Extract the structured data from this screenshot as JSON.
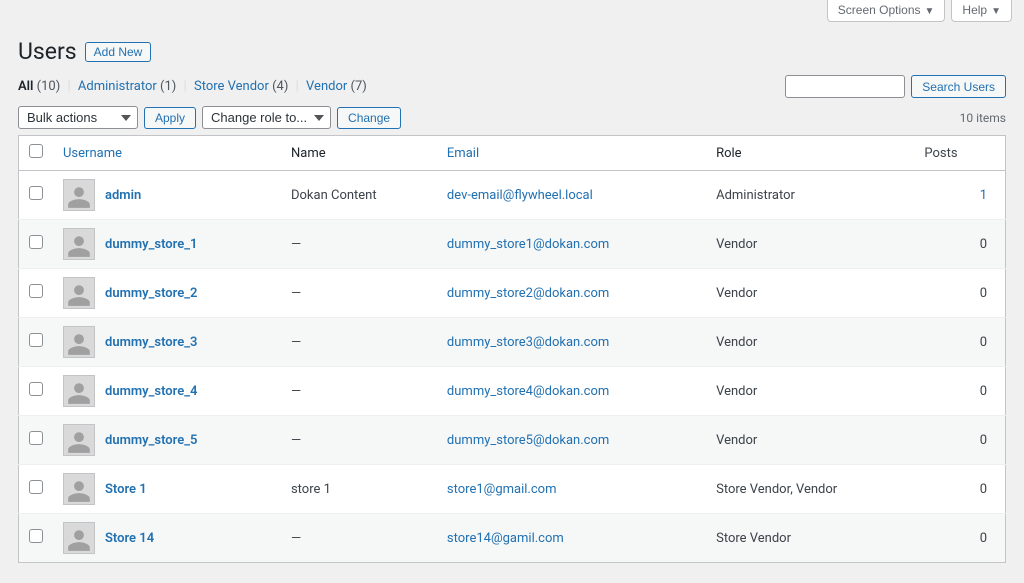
{
  "topbar": {
    "screen_options": "Screen Options",
    "help": "Help"
  },
  "header": {
    "title": "Users",
    "add_new": "Add New"
  },
  "filters": {
    "all": {
      "label": "All",
      "count": "(10)"
    },
    "administrator": {
      "label": "Administrator",
      "count": "(1)"
    },
    "store_vendor": {
      "label": "Store Vendor",
      "count": "(4)"
    },
    "vendor": {
      "label": "Vendor",
      "count": "(7)"
    }
  },
  "search": {
    "button": "Search Users"
  },
  "bulk": {
    "actions_label": "Bulk actions",
    "apply": "Apply",
    "change_role_label": "Change role to...",
    "change": "Change"
  },
  "pagination": {
    "items": "10 items"
  },
  "columns": {
    "username": "Username",
    "name": "Name",
    "email": "Email",
    "role": "Role",
    "posts": "Posts"
  },
  "rows": [
    {
      "username": "admin",
      "name": "Dokan Content",
      "email": "dev-email@flywheel.local",
      "role": "Administrator",
      "posts": "1",
      "posts_link": true
    },
    {
      "username": "dummy_store_1",
      "name": "—",
      "email": "dummy_store1@dokan.com",
      "role": "Vendor",
      "posts": "0"
    },
    {
      "username": "dummy_store_2",
      "name": "—",
      "email": "dummy_store2@dokan.com",
      "role": "Vendor",
      "posts": "0"
    },
    {
      "username": "dummy_store_3",
      "name": "—",
      "email": "dummy_store3@dokan.com",
      "role": "Vendor",
      "posts": "0"
    },
    {
      "username": "dummy_store_4",
      "name": "—",
      "email": "dummy_store4@dokan.com",
      "role": "Vendor",
      "posts": "0"
    },
    {
      "username": "dummy_store_5",
      "name": "—",
      "email": "dummy_store5@dokan.com",
      "role": "Vendor",
      "posts": "0"
    },
    {
      "username": "Store 1",
      "name": "store 1",
      "email": "store1@gmail.com",
      "role": "Store Vendor, Vendor",
      "posts": "0"
    },
    {
      "username": "Store 14",
      "name": "—",
      "email": "store14@gamil.com",
      "role": "Store Vendor",
      "posts": "0"
    }
  ]
}
